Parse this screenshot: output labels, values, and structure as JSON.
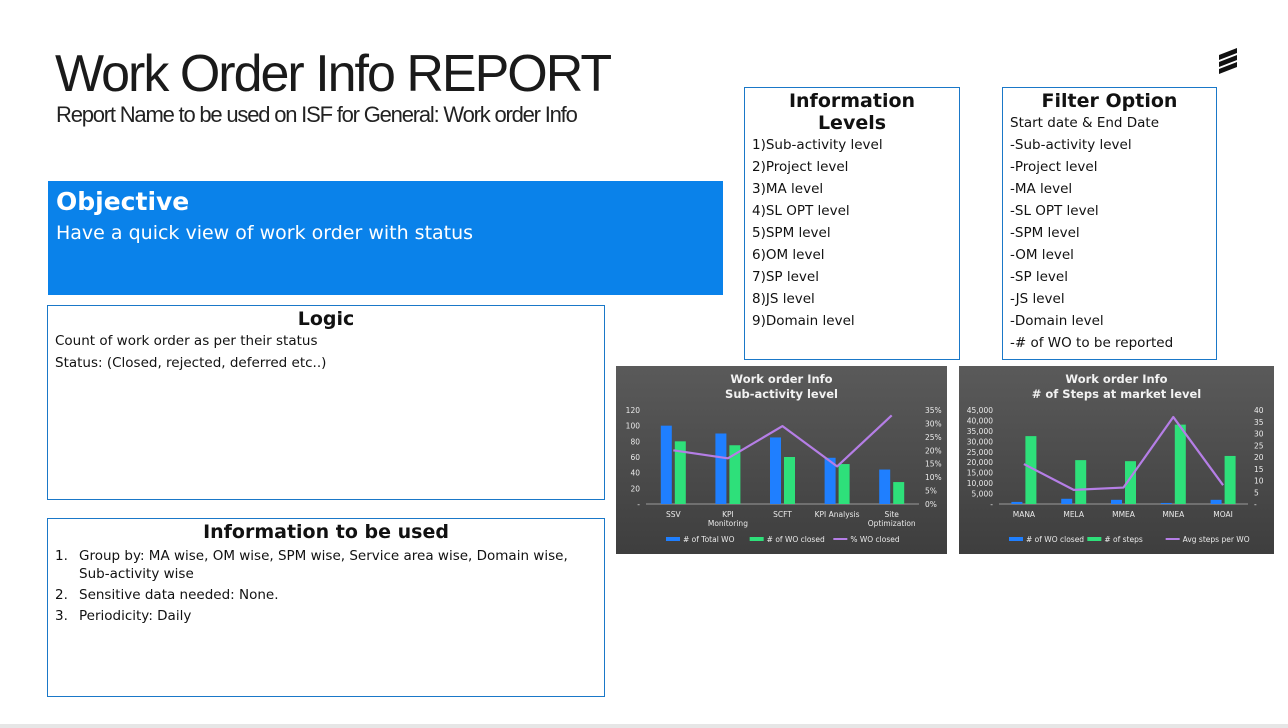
{
  "header": {
    "title": "Work Order Info REPORT",
    "subtitle": "Report Name to be used on ISF for General: Work order Info"
  },
  "logo": {
    "icon": "ericsson-logo-icon"
  },
  "objective": {
    "heading": "Objective",
    "text": "Have a quick view of work order with status",
    "color": "#0a82ea"
  },
  "logic": {
    "heading": "Logic",
    "lines": [
      "Count of work order as per their status",
      "Status: (Closed, rejected, deferred etc..)"
    ]
  },
  "info_used": {
    "heading": "Information to be used",
    "items": [
      {
        "num": "1.",
        "text": "Group by: MA wise, OM wise, SPM wise, Service area  wise, Domain wise, Sub-activity wise"
      },
      {
        "num": "2.",
        "text": "Sensitive data needed: None."
      },
      {
        "num": "3.",
        "text": "Periodicity: Daily"
      }
    ]
  },
  "info_levels": {
    "heading": "Information Levels",
    "items": [
      "1)Sub-activity level",
      "2)Project level",
      "3)MA level",
      "4)SL OPT level",
      "5)SPM level",
      "6)OM level",
      "7)SP level",
      "8)JS level",
      "9)Domain level"
    ]
  },
  "filter_option": {
    "heading": "Filter Option",
    "items": [
      "Start date & End Date",
      "-Sub-activity level",
      "-Project level",
      "-MA level",
      "-SL OPT level",
      "-SPM level",
      "-OM level",
      "-SP level",
      "-JS level",
      "-Domain level",
      "-# of WO to be reported"
    ]
  },
  "chart_data": [
    {
      "type": "bar",
      "title": "Work order Info",
      "subtitle": "Sub-activity level",
      "categories": [
        "SSV",
        "KPI Monitoring",
        "SCFT",
        "KPI Analysis",
        "Site Optimization"
      ],
      "category_lines": [
        [
          "SSV"
        ],
        [
          "KPI",
          "Monitoring"
        ],
        [
          "SCFT"
        ],
        [
          "KPI Analysis"
        ],
        [
          "Site",
          "Optimization"
        ]
      ],
      "series": [
        {
          "name": "# of Total WO",
          "type": "bar",
          "axis": "left",
          "color": "#1f7fff",
          "values": [
            100,
            90,
            85,
            59,
            44
          ]
        },
        {
          "name": "# of WO closed",
          "type": "bar",
          "axis": "left",
          "color": "#2ee07a",
          "values": [
            80,
            75,
            60,
            51,
            28
          ]
        },
        {
          "name": "% WO closed",
          "type": "line",
          "axis": "right",
          "color": "#b57ee6",
          "values": [
            0.2,
            0.17,
            0.29,
            0.14,
            0.33
          ]
        }
      ],
      "ylim": [
        0,
        120
      ],
      "yticks": [
        "-",
        "20",
        "40",
        "60",
        "80",
        "100",
        "120"
      ],
      "y2lim": [
        0,
        0.35
      ],
      "y2ticks": [
        "0%",
        "5%",
        "10%",
        "15%",
        "20%",
        "25%",
        "30%",
        "35%"
      ],
      "legend": "bottom"
    },
    {
      "type": "bar",
      "title": "Work order Info",
      "subtitle": "# of Steps at market level",
      "categories": [
        "MANA",
        "MELA",
        "MMEA",
        "MNEA",
        "MOAI"
      ],
      "category_lines": [
        [
          "MANA"
        ],
        [
          "MELA"
        ],
        [
          "MMEA"
        ],
        [
          "MNEA"
        ],
        [
          "MOAI"
        ]
      ],
      "series": [
        {
          "name": "# of WO closed",
          "type": "bar",
          "axis": "left",
          "color": "#1f7fff",
          "values": [
            1000,
            2500,
            2000,
            500,
            2000
          ]
        },
        {
          "name": "# of steps",
          "type": "bar",
          "axis": "left",
          "color": "#2ee07a",
          "values": [
            32500,
            21000,
            20500,
            38000,
            23000
          ]
        },
        {
          "name": "Avg steps per WO",
          "type": "line",
          "axis": "right",
          "color": "#b57ee6",
          "values": [
            17,
            6,
            7,
            37,
            8
          ]
        }
      ],
      "ylim": [
        0,
        45000
      ],
      "yticks": [
        "-",
        "5,000",
        "10,000",
        "15,000",
        "20,000",
        "25,000",
        "30,000",
        "35,000",
        "40,000",
        "45,000"
      ],
      "y2lim": [
        0,
        40
      ],
      "y2ticks": [
        "-",
        "5",
        "10",
        "15",
        "20",
        "25",
        "30",
        "35",
        "40"
      ],
      "legend": "bottom"
    }
  ]
}
